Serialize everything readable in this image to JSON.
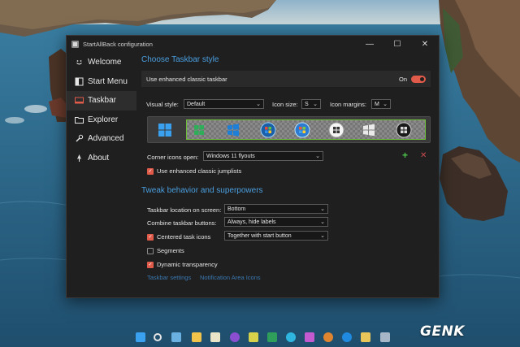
{
  "window": {
    "title": "StartAllBack configuration",
    "controls": {
      "minimize": "—",
      "maximize": "☐",
      "close": "✕"
    }
  },
  "sidebar": {
    "items": [
      {
        "label": "Welcome",
        "icon": "smile-icon",
        "active": false
      },
      {
        "label": "Start Menu",
        "icon": "start-menu-icon",
        "active": false
      },
      {
        "label": "Taskbar",
        "icon": "taskbar-icon",
        "active": true
      },
      {
        "label": "Explorer",
        "icon": "folder-icon",
        "active": false
      },
      {
        "label": "Advanced",
        "icon": "wrench-icon",
        "active": false
      },
      {
        "label": "About",
        "icon": "about-icon",
        "active": false
      }
    ]
  },
  "taskbar_style": {
    "heading": "Choose Taskbar style",
    "enhanced_label": "Use enhanced classic taskbar",
    "enhanced_state": "On",
    "enhanced_on": true,
    "visual_style_label": "Visual style:",
    "visual_style_value": "Default",
    "icon_size_label": "Icon size:",
    "icon_size_value": "S",
    "icon_margins_label": "Icon margins:",
    "icon_margins_value": "M",
    "style_options": [
      "windows-11-logo-icon",
      "green-orb-icon",
      "windows-10-logo-icon",
      "vista-orb-icon",
      "windows-7-orb-icon",
      "windows-xp-orb-icon",
      "windows-logo-icon",
      "dark-orb-icon"
    ],
    "corner_icons_label": "Corner icons open:",
    "corner_icons_value": "Windows 11 flyouts",
    "jumplists_label": "Use enhanced classic jumplists",
    "jumplists_checked": true
  },
  "tweaks": {
    "heading": "Tweak behavior and superpowers",
    "location_label": "Taskbar location on screen:",
    "location_value": "Bottom",
    "combine_label": "Combine taskbar buttons:",
    "combine_value": "Always, hide labels",
    "centered_label": "Centered task icons",
    "centered_checked": true,
    "centered_value": "Together with start button",
    "segments_label": "Segments",
    "segments_checked": false,
    "transparency_label": "Dynamic transparency",
    "transparency_checked": true,
    "links": [
      "Taskbar settings",
      "Notification Area Icons"
    ]
  },
  "watermark": "GENK",
  "colors": {
    "accent_blue": "#4a9fe0",
    "accent_red": "#e05b4a",
    "window_bg": "#1f1f1f"
  }
}
